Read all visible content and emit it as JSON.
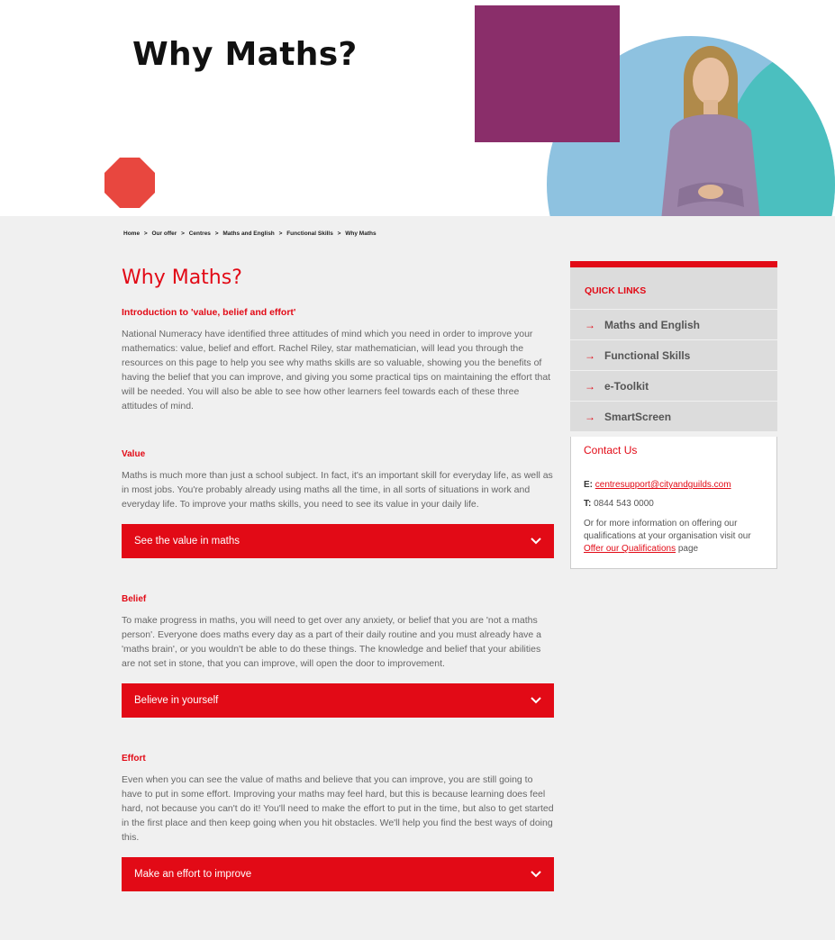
{
  "hero": {
    "title": "Why Maths?"
  },
  "breadcrumb": [
    "Home",
    ">",
    "Our offer",
    ">",
    "Centres",
    ">",
    "Maths and English",
    ">",
    "Functional Skills",
    ">",
    "Why Maths"
  ],
  "content": {
    "title": "Why Maths?",
    "intro_heading": "Introduction to 'value, belief and effort'",
    "intro_text": "National Numeracy have identified three attitudes of mind which you need in order to improve your mathematics: value, belief and effort. Rachel Riley, star mathematician, will lead you through the resources on this page to help you see why maths skills are so valuable, showing you the benefits of having the belief that you can improve, and giving you some practical tips on maintaining the effort that will be needed. You will also be able to see how other learners feel towards each of these three attitudes of mind.",
    "sections": [
      {
        "heading": "Value",
        "text": "Maths is much more than just a school subject. In fact, it's an important skill for everyday life, as well as in most jobs. You're probably already using maths all the time, in all sorts of situations in work and everyday life. To improve your maths skills, you need to see its value in your daily life.",
        "button": "See the value in maths"
      },
      {
        "heading": "Belief",
        "text": "To make progress in maths, you will need to get over any anxiety, or belief that you are 'not a maths person'. Everyone does maths every day as a part of their daily routine and you must already have a 'maths brain', or you wouldn't be able to do these things. The knowledge and belief that your abilities are not set in stone, that you can improve, will open the door to improvement.",
        "button": "Believe in yourself"
      },
      {
        "heading": "Effort",
        "text": "Even when you can see the value of maths and believe that you can improve, you are still going to have to put in some effort. Improving your maths may feel hard, but this is because learning does feel hard, not because you can't do it! You'll need to make the effort to put in the time, but also to get started in the first place and then keep going when you hit obstacles. We'll help you find the best ways of doing this.",
        "button": "Make an effort to improve"
      }
    ]
  },
  "sidebar": {
    "quick_links_title": "QUICK LINKS",
    "links": [
      "Maths and English",
      "Functional Skills",
      "e-Toolkit",
      "SmartScreen"
    ],
    "arrow": "→",
    "contact_title": "Contact Us",
    "email_label": "E:",
    "email": "centresupport@cityandguilds.com",
    "phone_label": "T:",
    "phone": "0844 543 0000",
    "more_text_before": "Or for more information on offering our qualifications at your organisation visit our",
    "more_link": "Offer our Qualifications",
    "more_text_after": "page"
  },
  "colors": {
    "brand_red": "#e20a16",
    "purple": "#8a2e6a",
    "light_blue": "#8ec2e0",
    "teal": "#4bbfbf"
  }
}
